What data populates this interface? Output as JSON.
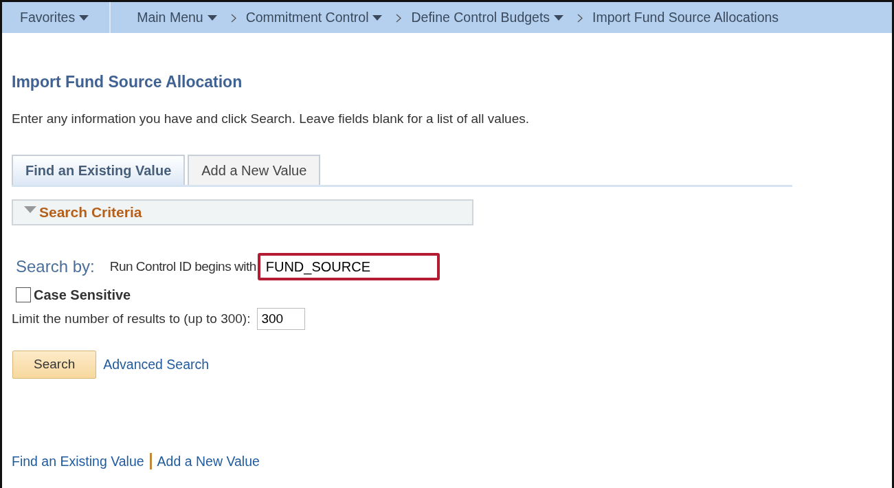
{
  "breadcrumb": [
    {
      "label": "Favorites",
      "dropdown": true,
      "separator_before": false
    },
    {
      "label": "Main Menu",
      "dropdown": true,
      "separator_before": false
    },
    {
      "label": "Commitment Control",
      "dropdown": true,
      "separator_before": true
    },
    {
      "label": "Define Control Budgets",
      "dropdown": true,
      "separator_before": true
    },
    {
      "label": "Import Fund Source Allocations",
      "dropdown": false,
      "separator_before": true
    }
  ],
  "page_title": "Import Fund Source Allocation",
  "instructions": "Enter any information you have and click Search. Leave fields blank for a list of all values.",
  "tabs": [
    {
      "label": "Find an Existing Value",
      "selected": true
    },
    {
      "label": "Add a New Value",
      "selected": false
    }
  ],
  "search_criteria": {
    "title": "Search Criteria",
    "expanded": true
  },
  "search_by": {
    "label": "Search by:",
    "field_label": "Run Control ID begins with",
    "value": "FUND_SOURCE",
    "highlighted": true
  },
  "case_sensitive": {
    "label": "Case Sensitive",
    "checked": false
  },
  "limit": {
    "label": "Limit the number of results to (up to 300):",
    "value": "300"
  },
  "search_button": "Search",
  "advanced_search": "Advanced Search",
  "footer_links": [
    "Find an Existing Value",
    "Add a New Value"
  ]
}
